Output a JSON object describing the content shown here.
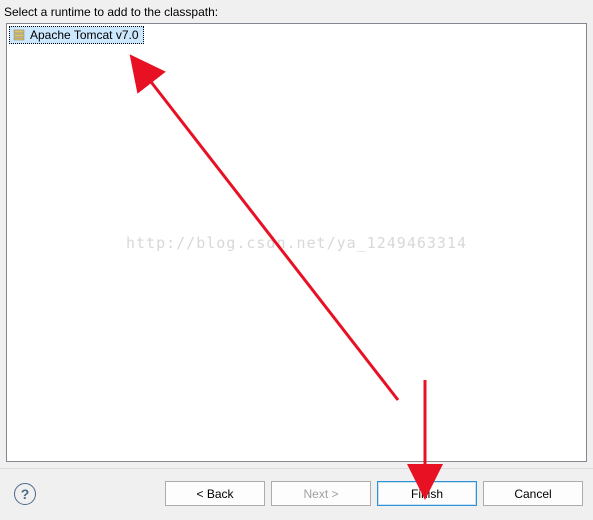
{
  "prompt": "Select a runtime to add to the classpath:",
  "runtimes": [
    {
      "label": "Apache Tomcat v7.0"
    }
  ],
  "watermark": "http://blog.csdn.net/ya_1249463314",
  "buttons": {
    "back": "< Back",
    "next": "Next >",
    "finish": "Finish",
    "cancel": "Cancel"
  },
  "help_symbol": "?"
}
